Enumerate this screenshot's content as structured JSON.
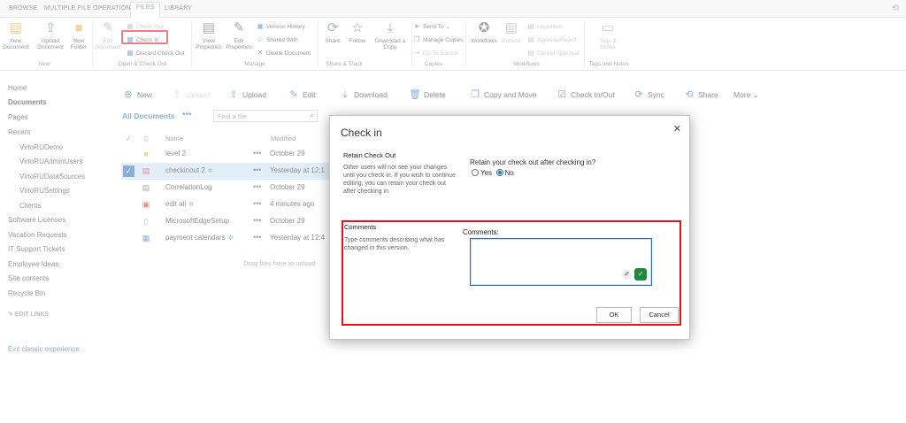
{
  "ribbon_tabs": [
    "BROWSE",
    "MULTIPLE FILE OPERATIONS",
    "FILES",
    "LIBRARY"
  ],
  "ribbon": {
    "new_document": "New Document",
    "upload_document": "Upload Document",
    "new_folder": "New Folder",
    "edit_document": "Edit Document",
    "check_out": "Check Out",
    "check_in": "Check In",
    "discard_check_out": "Discard Check Out",
    "view_properties": "View Properties",
    "edit_properties": "Edit Properties",
    "version_history": "Version History",
    "shared_with": "Shared With",
    "delete_document": "Delete Document",
    "share": "Share",
    "follow": "Follow",
    "download_copy": "Download a Copy",
    "send_to": "Send To",
    "manage_copies": "Manage Copies",
    "go_to_source": "Go To Source",
    "workflows": "Workflows",
    "publish": "Publish",
    "unpublish": "Unpublish",
    "approve_reject": "Approve/Reject",
    "cancel_approval": "Cancel Approval",
    "tags_notes": "Tags & Notes",
    "groups": [
      "New",
      "Open & Check Out",
      "Manage",
      "Share & Track",
      "Copies",
      "Workflows",
      "Tags and Notes"
    ]
  },
  "nav": {
    "items": [
      "Home",
      "Documents",
      "Pages",
      "Recent",
      "VirtoRUDemo",
      "VirtoRUAdminUsers",
      "VirtoRUDataSources",
      "VirtoRUSettings",
      "Clients",
      "Software Licenses",
      "Vacation Requests",
      "IT Support Tickets",
      "Employee Ideas",
      "Site contents",
      "Recycle Bin"
    ],
    "edit_links": "EDIT LINKS",
    "exit_classic": "Exit classic experience"
  },
  "commands": [
    "New",
    "Upload",
    "Upload",
    "Edit",
    "Download",
    "Delete",
    "Copy and Move",
    "Check In/Out",
    "Sync",
    "Share",
    "More"
  ],
  "view": {
    "title": "All Documents",
    "more": "•••",
    "search_placeholder": "Find a file"
  },
  "list": {
    "col_name": "Name",
    "col_modified": "Modified",
    "rows": [
      {
        "name": "level 2",
        "modified": "October 29",
        "new": false
      },
      {
        "name": "checkinout 2",
        "modified": "Yesterday at 12:1",
        "new": true
      },
      {
        "name": "CorrelationLog",
        "modified": "October 29",
        "new": false
      },
      {
        "name": "edit all",
        "modified": "4 minutes ago",
        "new": true
      },
      {
        "name": "MicrosoftEdgeSetup",
        "modified": "October 29",
        "new": false
      },
      {
        "name": "payment calendars",
        "modified": "Yesterday at 12:4",
        "new": true
      }
    ],
    "drag_hint": "Drag files here to upload"
  },
  "dialog": {
    "title": "Check in",
    "retain_title": "Retain Check Out",
    "retain_desc": "Other users will not see your changes until you check in. If you wish to continue editing, you can retain your check out after checking in.",
    "retain_question": "Retain your check out after checking in?",
    "opt_yes": "Yes",
    "opt_no": "No",
    "comments_title": "Comments",
    "comments_desc": "Type comments describing what has changed in this version.",
    "comments_label": "Comments:",
    "comments_value": "",
    "ok": "OK",
    "cancel": "Cancel"
  }
}
